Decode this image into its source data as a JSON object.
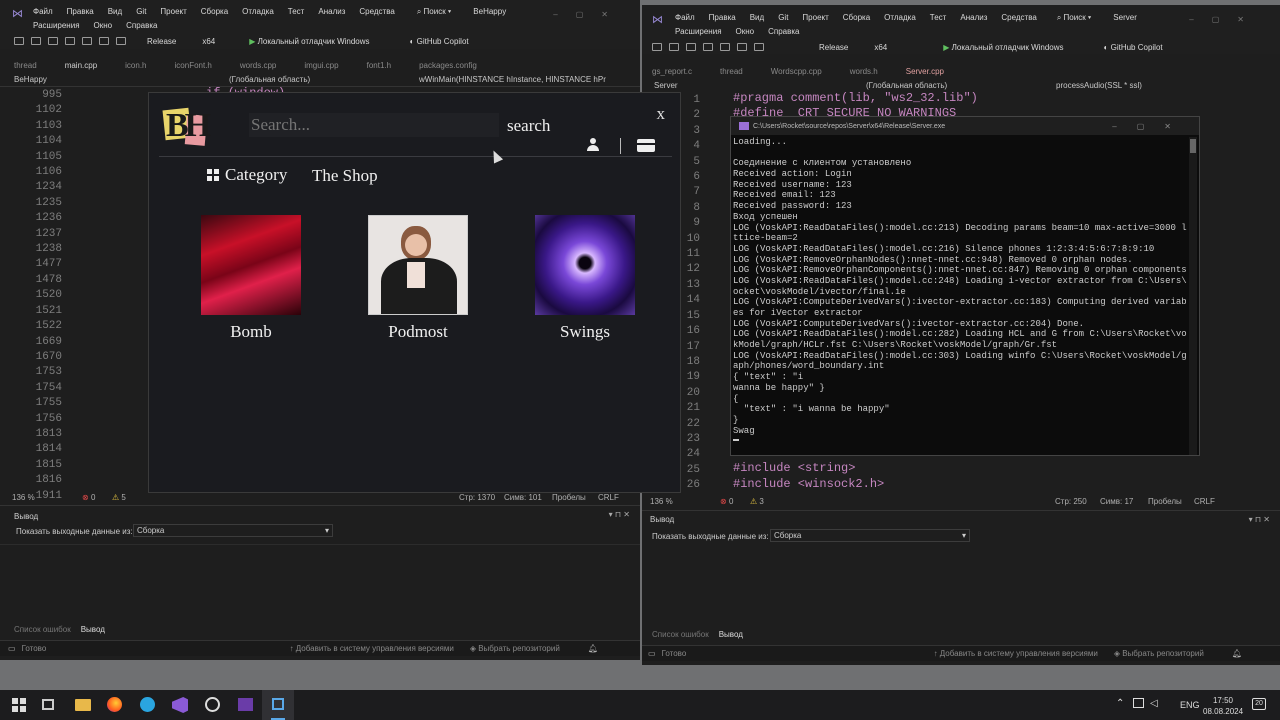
{
  "left_vs": {
    "menu": [
      "Файл",
      "Правка",
      "Вид",
      "Git",
      "Проект",
      "Сборка",
      "Отладка",
      "Тест",
      "Анализ",
      "Средства"
    ],
    "menu2": [
      "Расширения",
      "Окно",
      "Справка"
    ],
    "search_label": "Поиск ▾",
    "solution": "BeHappy",
    "config": "Release",
    "platform": "x64",
    "debugger": "Локальный отладчик Windows",
    "copilot": "GitHub Copilot",
    "tabs": [
      "thread",
      "main.cpp",
      "icon.h",
      "iconFont.h",
      "words.cpp",
      "imgui.cpp",
      "font1.h",
      "packages.config"
    ],
    "nav_project": "BeHappy",
    "nav_scope": "(Глобальная область)",
    "nav_func": "wWinMain(HINSTANCE hInstance, HINSTANCE hPr",
    "line_numbers": [
      "995",
      "1102",
      "1103",
      "1104",
      "1105",
      "1106",
      "1234",
      "1235",
      "1236",
      "1237",
      "1238",
      "1477",
      "1478",
      "1520",
      "1521",
      "1522",
      "1669",
      "1670",
      "1753",
      "1754",
      "1755",
      "1756",
      "1813",
      "1814",
      "1815",
      "1816",
      "1911"
    ],
    "code_top": "if (window)",
    "zoom": "136 %",
    "errors": "0",
    "warnings": "5",
    "pos_line": "Стр: 1370",
    "pos_col": "Симв: 101",
    "spaces": "Пробелы",
    "eol": "CRLF",
    "output_title": "Вывод",
    "output_from": "Показать выходные данные из:",
    "output_source": "Сборка",
    "bottom_tab1": "Список ошибок",
    "bottom_tab2": "Вывод",
    "status_ready": "Готово",
    "status_vcs": "Добавить в систему управления версиями",
    "status_repo": "Выбрать репозиторий"
  },
  "app": {
    "logo_text": "BH",
    "search_placeholder": "Search...",
    "search_button": "search",
    "close": "x",
    "category_label": "Category",
    "shop_title": "The Shop",
    "items": [
      {
        "name": "Bomb",
        "color": "#c0102a"
      },
      {
        "name": "Podmost",
        "color": "#d8d0c8"
      },
      {
        "name": "Swings",
        "color": "#6a3cc0"
      }
    ]
  },
  "right_vs": {
    "menu": [
      "Файл",
      "Правка",
      "Вид",
      "Git",
      "Проект",
      "Сборка",
      "Отладка",
      "Тест",
      "Анализ",
      "Средства"
    ],
    "menu2": [
      "Расширения",
      "Окно",
      "Справка"
    ],
    "search_label": "Поиск ▾",
    "solution": "Server",
    "config": "Release",
    "platform": "x64",
    "debugger": "Локальный отладчик Windows",
    "copilot": "GitHub Copilot",
    "tabs": [
      "gs_report.c",
      "thread",
      "Wordscpp.cpp",
      "words.h",
      "Server.cpp"
    ],
    "nav_project": "Server",
    "nav_scope": "(Глобальная область)",
    "nav_func": "processAudio(SSL * ssl)",
    "code_line1": "#pragma comment(lib, \"ws2_32.lib\")",
    "code_line2": "#define _CRT_SECURE_NO_WARNINGS",
    "code_include1": "#include <string>",
    "code_include2": "#include <winsock2.h>",
    "line_numbers": [
      "1",
      "2",
      "3",
      "4",
      "5",
      "6",
      "7",
      "8",
      "9",
      "10",
      "11",
      "12",
      "13",
      "14",
      "15",
      "16",
      "17",
      "18",
      "19",
      "20",
      "21",
      "22",
      "23",
      "24",
      "25",
      "26"
    ],
    "zoom": "136 %",
    "errors": "0",
    "warnings": "3",
    "pos_line": "Стр: 250",
    "pos_col": "Симв: 17",
    "spaces": "Пробелы",
    "eol": "CRLF",
    "output_title": "Вывод",
    "output_from": "Показать выходные данные из:",
    "output_source": "Сборка",
    "bottom_tab1": "Список ошибок",
    "bottom_tab2": "Вывод",
    "status_ready": "Готово",
    "status_vcs": "Добавить в систему управления версиями",
    "status_repo": "Выбрать репозиторий"
  },
  "console": {
    "title": "C:\\Users\\Rocket\\source\\repos\\Server\\x64\\Release\\Server.exe",
    "lines": [
      "Loading...",
      "",
      "Соединение с клиентом установлено",
      "Received action: Login",
      "Received username: 123",
      "Received email: 123",
      "Received password: 123",
      "Вход успешен",
      "LOG (VoskAPI:ReadDataFiles():model.cc:213) Decoding params beam=10 max-active=3000 la",
      "ttice-beam=2",
      "LOG (VoskAPI:ReadDataFiles():model.cc:216) Silence phones 1:2:3:4:5:6:7:8:9:10",
      "LOG (VoskAPI:RemoveOrphanNodes():nnet-nnet.cc:948) Removed 0 orphan nodes.",
      "LOG (VoskAPI:RemoveOrphanComponents():nnet-nnet.cc:847) Removing 0 orphan components.",
      "LOG (VoskAPI:ReadDataFiles():model.cc:248) Loading i-vector extractor from C:\\Users\\R",
      "ocket\\voskModel/ivector/final.ie",
      "LOG (VoskAPI:ComputeDerivedVars():ivector-extractor.cc:183) Computing derived variabl",
      "es for iVector extractor",
      "LOG (VoskAPI:ComputeDerivedVars():ivector-extractor.cc:204) Done.",
      "LOG (VoskAPI:ReadDataFiles():model.cc:282) Loading HCL and G from C:\\Users\\Rocket\\vos",
      "kModel/graph/HCLr.fst C:\\Users\\Rocket\\voskModel/graph/Gr.fst",
      "LOG (VoskAPI:ReadDataFiles():model.cc:303) Loading winfo C:\\Users\\Rocket\\voskModel/gr",
      "aph/phones/word_boundary.int",
      "{ \"text\" : \"i",
      "wanna be happy\" }",
      "{",
      "  \"text\" : \"i wanna be happy\"",
      "}",
      "Swag"
    ]
  },
  "taskbar": {
    "lang": "ENG",
    "time": "17:50",
    "date": "08.08.2024",
    "notif": "20"
  }
}
